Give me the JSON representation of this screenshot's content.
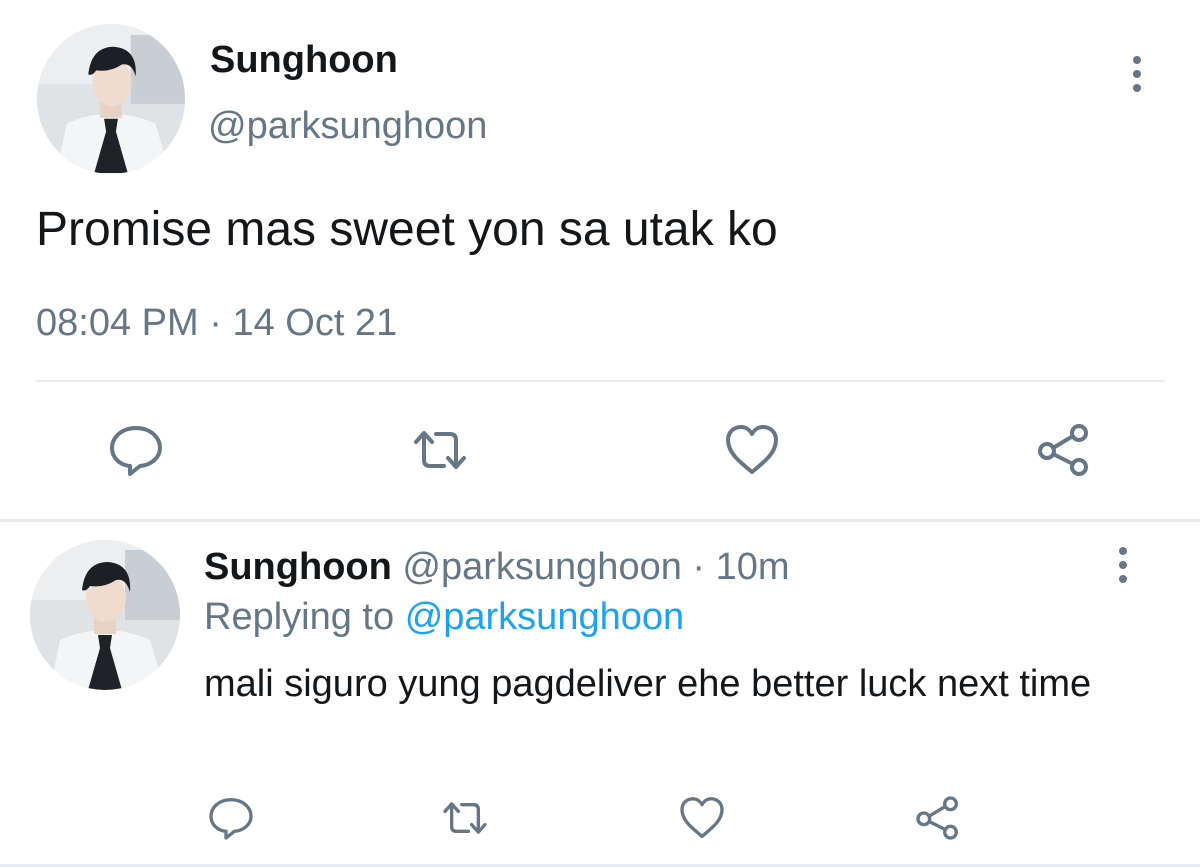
{
  "main_tweet": {
    "display_name": "Sunghoon",
    "handle": "@parksunghoon",
    "text": "Promise mas sweet yon sa utak ko",
    "time": "08:04 PM",
    "separator": "·",
    "date": "14 Oct 21",
    "actions": [
      "reply-icon",
      "retweet-icon",
      "like-icon",
      "share-icon"
    ]
  },
  "reply_tweet": {
    "display_name": "Sunghoon",
    "handle": "@parksunghoon",
    "separator": "·",
    "time_ago": "10m",
    "replying_prefix": "Replying to",
    "replying_to": "@parksunghoon",
    "text": "mali siguro yung pagdeliver ehe better luck next time",
    "actions": [
      "reply-icon",
      "retweet-icon",
      "like-icon",
      "share-icon"
    ]
  },
  "colors": {
    "primary_text": "#14171a",
    "secondary_text": "#657786",
    "link": "#1da1f2",
    "divider": "#e6ecf0"
  }
}
